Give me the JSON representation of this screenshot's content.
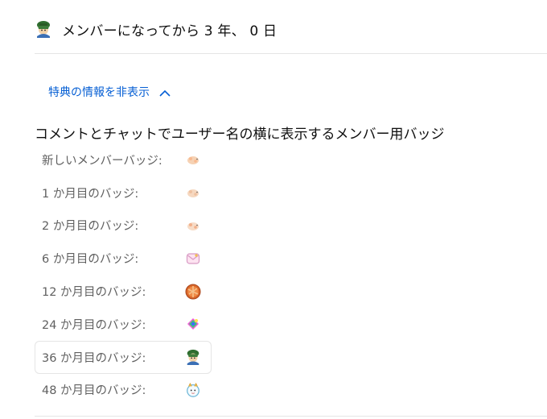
{
  "header": {
    "title": "メンバーになってから 3 年、 0 日",
    "avatar_icon": "member-avatar-icon"
  },
  "perks_toggle": {
    "label": "特典の情報を非表示",
    "icon": "chevron-up-icon",
    "color": "#065fd4"
  },
  "badges_section": {
    "title": "コメントとチャットでユーザー名の横に表示するメンバー用バッジ",
    "badges": [
      {
        "label": "新しいメンバーバッジ:",
        "icon": "hamster-badge-icon"
      },
      {
        "label": "1 か月目のバッジ:",
        "icon": "hamster-badge-icon"
      },
      {
        "label": "2 か月目のバッジ:",
        "icon": "hamster-badge-icon"
      },
      {
        "label": "6 か月目のバッジ:",
        "icon": "envelope-badge-icon"
      },
      {
        "label": "12 か月目のバッジ:",
        "icon": "donut-badge-icon"
      },
      {
        "label": "24 か月目のバッジ:",
        "icon": "rainbow-badge-icon"
      },
      {
        "label": "36 か月目のバッジ:",
        "icon": "member-avatar-badge-icon",
        "selected": true
      },
      {
        "label": "48 か月目のバッジ:",
        "icon": "white-creature-badge-icon"
      }
    ]
  }
}
